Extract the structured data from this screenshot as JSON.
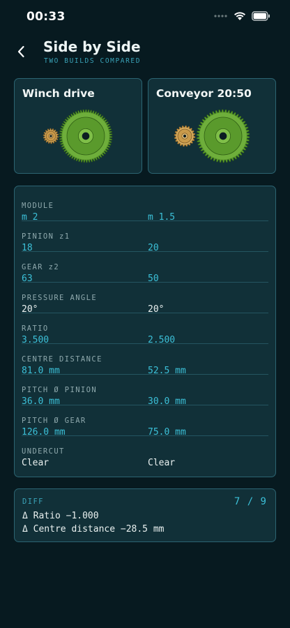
{
  "status": {
    "time": "00:33"
  },
  "header": {
    "title": "Side by Side",
    "subtitle": "TWO BUILDS COMPARED"
  },
  "builds": [
    {
      "name": "Winch drive"
    },
    {
      "name": "Conveyor 20:50"
    }
  ],
  "specs": [
    {
      "label": "MODULE",
      "a": "m 2",
      "b": "m 1.5",
      "color": "cyan"
    },
    {
      "label": "PINION z1",
      "a": "18",
      "b": "20",
      "color": "cyan"
    },
    {
      "label": "GEAR z2",
      "a": "63",
      "b": "50",
      "color": "cyan"
    },
    {
      "label": "PRESSURE ANGLE",
      "a": "20°",
      "b": "20°",
      "color": "white"
    },
    {
      "label": "RATIO",
      "a": "3.500",
      "b": "2.500",
      "color": "cyan"
    },
    {
      "label": "CENTRE DISTANCE",
      "a": "81.0 mm",
      "b": "52.5 mm",
      "color": "cyan"
    },
    {
      "label": "PITCH Ø PINION",
      "a": "36.0 mm",
      "b": "30.0 mm",
      "color": "cyan"
    },
    {
      "label": "PITCH Ø GEAR",
      "a": "126.0 mm",
      "b": "75.0 mm",
      "color": "cyan"
    },
    {
      "label": "UNDERCUT",
      "a": "Clear",
      "b": "Clear",
      "color": "white"
    }
  ],
  "diff": {
    "label": "DIFF",
    "count": "7 / 9",
    "lines": [
      "Δ Ratio −1.000",
      "Δ Centre distance −28.5 mm"
    ]
  },
  "colors": {
    "background": "#071a20",
    "card": "#113038",
    "accent": "#3cc0d8",
    "gear_green": "#5a9a2c",
    "gear_brass": "#c99a4a"
  }
}
